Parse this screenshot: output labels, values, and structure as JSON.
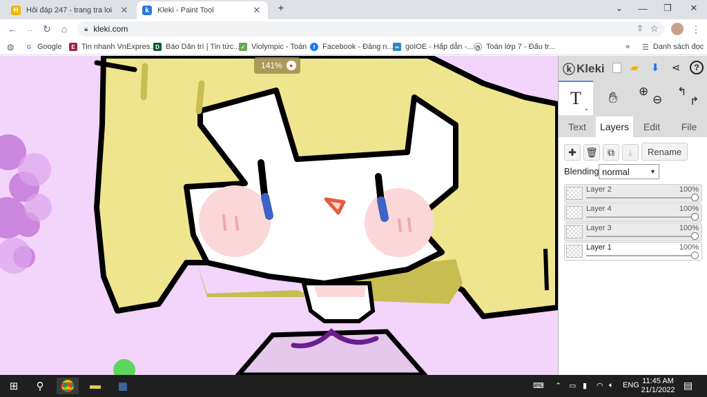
{
  "browser": {
    "tabs": [
      {
        "title": "Hỏi đáp 247 - trang tra loi",
        "favicon": "hoidap-h-icon",
        "active": false
      },
      {
        "title": "Kleki - Paint Tool",
        "favicon": "kleki-icon",
        "active": true
      }
    ],
    "new_tab_label": "+",
    "window_controls": [
      "⌄",
      "—",
      "❐",
      "✕"
    ],
    "url": "kleki.com",
    "bookmarks": [
      {
        "label": "Google",
        "icon": "google-icon"
      },
      {
        "label": "Tin nhanh VnExpres...",
        "icon": "vnexpress-icon"
      },
      {
        "label": "Báo Dân trí | Tin tức...",
        "icon": "dantri-icon"
      },
      {
        "label": "Violympic - Toán",
        "icon": "violympic-icon"
      },
      {
        "label": "Facebook - Đăng n...",
        "icon": "facebook-icon"
      },
      {
        "label": "goIOE - Hấp dẫn -...",
        "icon": "goioe-icon"
      },
      {
        "label": "Toán lớp 7 - Đấu tr...",
        "icon": "timer-icon"
      }
    ],
    "bookmarks_overflow": "»",
    "reading_list": "Danh sách đọc"
  },
  "canvas": {
    "zoom": "141%"
  },
  "kleki": {
    "logo": "Kleki",
    "active_tool": "T",
    "tabs": [
      "Text",
      "Layers",
      "Edit",
      "File"
    ],
    "active_tab": "Layers",
    "rename_label": "Rename",
    "blending_label": "Blending",
    "blending_value": "normal",
    "layers": [
      {
        "name": "Layer 2",
        "opacity": "100%",
        "selected": false
      },
      {
        "name": "Layer 4",
        "opacity": "100%",
        "selected": false
      },
      {
        "name": "Layer 3",
        "opacity": "100%",
        "selected": false
      },
      {
        "name": "Layer 1",
        "opacity": "100%",
        "selected": true
      }
    ]
  },
  "taskbar": {
    "language": "ENG",
    "time": "11:45 AM",
    "date": "21/1/2022"
  },
  "colors": {
    "canvas_bg": "#f3d4fb",
    "hair": "#efe58f",
    "hair_shadow": "#c8bd50",
    "skin": "#ffffff",
    "blush": "#fbd7d8",
    "eye": "#3b64c4",
    "mouth": "#e65b3c",
    "collar": "#6a1d8c"
  }
}
